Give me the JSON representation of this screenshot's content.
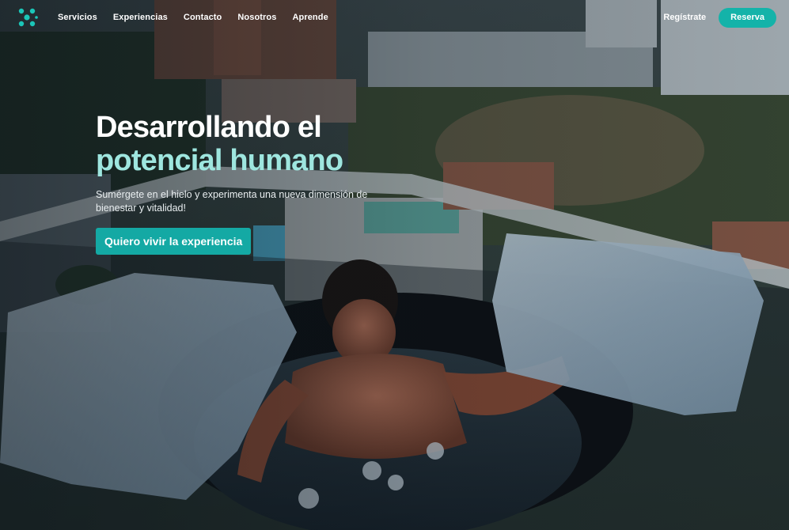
{
  "nav": {
    "logo_icon": "molecule-logo-icon",
    "links": [
      "Servicios",
      "Experiencias",
      "Contacto",
      "Nosotros",
      "Aprende"
    ],
    "register_label": "Regístrate",
    "reserve_label": "Reserva"
  },
  "hero": {
    "title_line1": "Desarrollando el",
    "title_line2": "potencial humano",
    "subtitle": "Sumérgete en el hielo y experimenta una nueva dimensión de bienestar y vitalidad!",
    "cta_label": "Quiero vivir la experiencia"
  },
  "colors": {
    "accent": "#14b3a9",
    "title_accent": "#9ee6df"
  }
}
